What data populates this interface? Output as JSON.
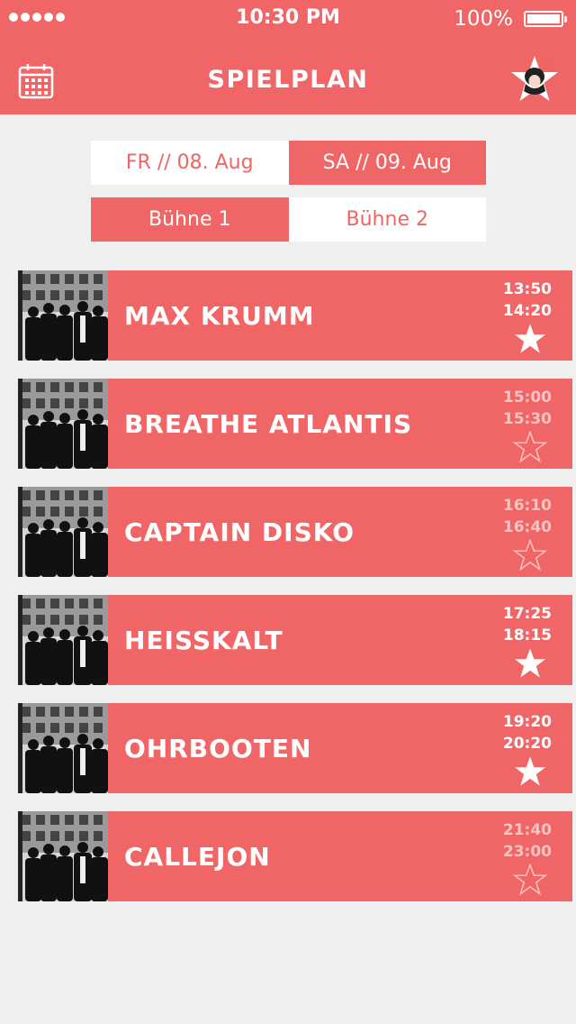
{
  "status_bar": {
    "time": "10:30 PM",
    "battery": "100%"
  },
  "header": {
    "title": "SPIELPLAN",
    "calendar_icon": "calendar-icon",
    "favorites_icon": "star-avatar-icon"
  },
  "days": [
    {
      "label": "FR // 08. Aug",
      "selected": false
    },
    {
      "label": "SA // 09. Aug",
      "selected": true
    }
  ],
  "stages": [
    {
      "label": "Bühne 1",
      "selected": true
    },
    {
      "label": "Bühne 2",
      "selected": false
    }
  ],
  "schedule": [
    {
      "band": "MAX KRUMM",
      "start": "13:50",
      "end": "14:20",
      "favorite": true
    },
    {
      "band": "BREATHE ATLANTIS",
      "start": "15:00",
      "end": "15:30",
      "favorite": false
    },
    {
      "band": "CAPTAIN DISKO",
      "start": "16:10",
      "end": "16:40",
      "favorite": false
    },
    {
      "band": "HEISSKALT",
      "start": "17:25",
      "end": "18:15",
      "favorite": true
    },
    {
      "band": "OHRBOOTEN",
      "start": "19:20",
      "end": "20:20",
      "favorite": true
    },
    {
      "band": "CALLEJON",
      "start": "21:40",
      "end": "23:00",
      "favorite": false
    }
  ],
  "colors": {
    "accent": "#f06565",
    "background": "#efefef",
    "surface": "#ffffff"
  }
}
